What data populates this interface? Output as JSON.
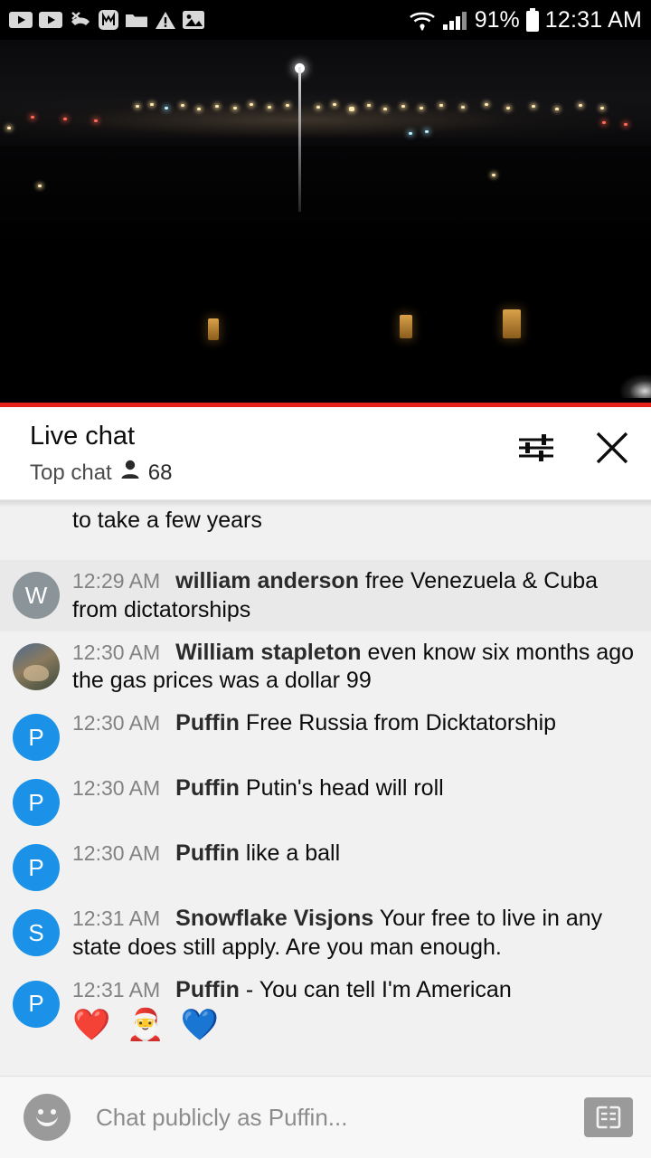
{
  "status_bar": {
    "battery_percent": "91%",
    "clock": "12:31 AM",
    "left_icons": [
      "youtube-icon",
      "youtube-icon-2",
      "missed-call-icon",
      "messenger-icon",
      "folder-icon",
      "warning-icon",
      "photo-icon"
    ],
    "right_icons": [
      "wifi-icon",
      "cellular-signal-icon",
      "battery-icon"
    ]
  },
  "video": {
    "progress_bar_color": "#e62117"
  },
  "chat_header": {
    "title": "Live chat",
    "mode": "Top chat",
    "viewer_count": "68",
    "settings_icon": "chat-settings-icon",
    "close_icon": "close-icon"
  },
  "messages": [
    {
      "partial": true,
      "avatar_letter": "",
      "avatar_color": "transparent",
      "timestamp": "",
      "author": "",
      "text": "to take a few years"
    },
    {
      "highlight": true,
      "avatar_letter": "W",
      "avatar_color": "#8b9499",
      "timestamp": "12:29 AM",
      "author": "william anderson",
      "text": "free Venezuela & Cuba from dictatorships"
    },
    {
      "avatar_letter": "",
      "avatar_photo": true,
      "avatar_color": "#5a6b7a",
      "timestamp": "12:30 AM",
      "author": "William stapleton",
      "text": "even know six months ago the gas prices was a dollar 99"
    },
    {
      "avatar_letter": "P",
      "avatar_color": "#1b92e8",
      "timestamp": "12:30 AM",
      "author": "Puffin",
      "text": "Free Russia from Dicktatorship"
    },
    {
      "avatar_letter": "P",
      "avatar_color": "#1b92e8",
      "timestamp": "12:30 AM",
      "author": "Puffin",
      "text": "Putin's head will roll"
    },
    {
      "avatar_letter": "P",
      "avatar_color": "#1b92e8",
      "timestamp": "12:30 AM",
      "author": "Puffin",
      "text": "like a ball"
    },
    {
      "avatar_letter": "S",
      "avatar_color": "#1b92e8",
      "timestamp": "12:31 AM",
      "author": "Snowflake Visjons",
      "text": "Your free to live in any state does still apply. Are you man enough."
    },
    {
      "avatar_letter": "P",
      "avatar_color": "#1b92e8",
      "timestamp": "12:31 AM",
      "author": "Puffin",
      "text": "- You can tell I'm American",
      "emoji": "❤️ 🎅 💙"
    }
  ],
  "composer": {
    "emoji_button_icon": "emoji-face-icon",
    "placeholder": "Chat publicly as Puffin...",
    "super_chat_icon": "super-chat-icon"
  }
}
